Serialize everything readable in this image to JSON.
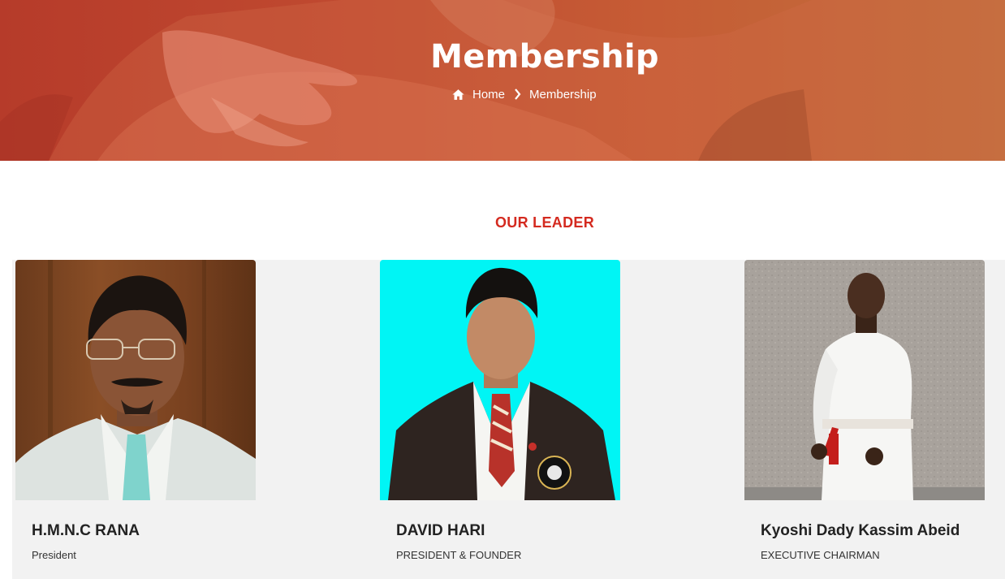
{
  "hero": {
    "title": "Membership",
    "breadcrumb": {
      "home": "Home",
      "current": "Membership"
    }
  },
  "section": {
    "title": "OUR LEADER"
  },
  "leaders": [
    {
      "name": "H.M.N.C RANA",
      "role": "President"
    },
    {
      "name": "DAVID HARI",
      "role": "PRESIDENT & FOUNDER"
    },
    {
      "name": "Kyoshi Dady Kassim Abeid",
      "role": "EXECUTIVE CHAIRMAN"
    }
  ],
  "icons": {
    "home": "home-icon",
    "separator": "chevron-right-icon"
  },
  "colors": {
    "accent": "#d42a1f",
    "banner": "#c04a30",
    "card_background": "#f2f2f2",
    "photo2_background": "#00f5f5"
  }
}
